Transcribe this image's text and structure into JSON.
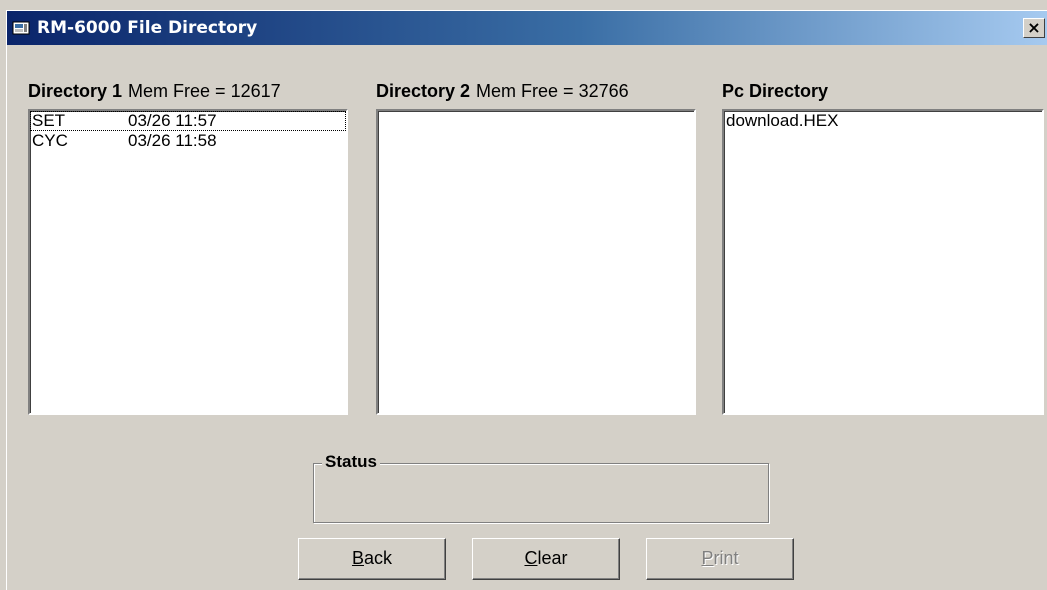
{
  "window": {
    "title": "RM-6000 File Directory",
    "close_label": "×",
    "app_icon": "rm6000-app-icon",
    "close_icon": "close-x-icon"
  },
  "directory1": {
    "title": "Directory 1",
    "mem_free": "Mem Free = 12617",
    "items": [
      {
        "name": "SET",
        "date": "03/26 11:57",
        "focused": true
      },
      {
        "name": "CYC",
        "date": "03/26 11:58",
        "focused": false
      }
    ]
  },
  "directory2": {
    "title": "Directory 2",
    "mem_free": "Mem Free = 32766",
    "items": []
  },
  "pc_directory": {
    "title": "Pc Directory",
    "items": [
      {
        "name": "download.HEX"
      }
    ]
  },
  "status": {
    "label": "Status",
    "text": ""
  },
  "buttons": {
    "back": {
      "accel": "B",
      "rest": "ack",
      "enabled": true
    },
    "clear": {
      "accel": "C",
      "rest": "lear",
      "enabled": true
    },
    "print": {
      "accel": "P",
      "rest": "rint",
      "enabled": false
    }
  },
  "colors": {
    "title_gradient_start": "#0a246a",
    "title_gradient_end": "#a6caf0",
    "window_bg": "#d4d0c8",
    "disabled_text": "#808080"
  }
}
